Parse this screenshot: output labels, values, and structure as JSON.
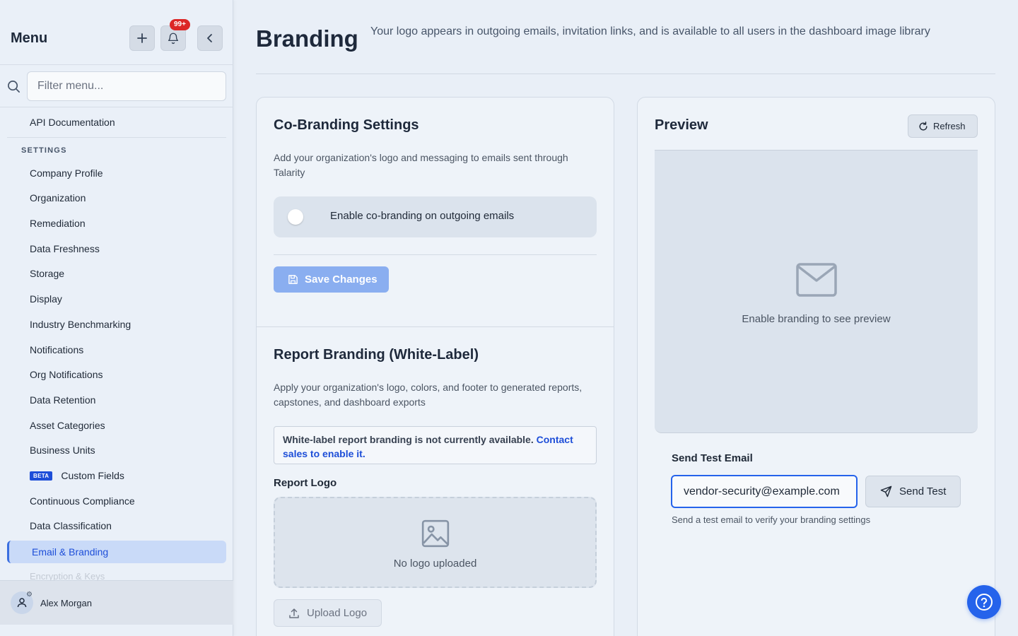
{
  "sidebar": {
    "title": "Menu",
    "notification_badge": "99+",
    "search_placeholder": "Filter menu...",
    "top_item": "API Documentation",
    "section_label": "SETTINGS",
    "items": [
      {
        "label": "Company Profile"
      },
      {
        "label": "Organization"
      },
      {
        "label": "Remediation"
      },
      {
        "label": "Data Freshness"
      },
      {
        "label": "Storage"
      },
      {
        "label": "Display"
      },
      {
        "label": "Industry Benchmarking"
      },
      {
        "label": "Notifications"
      },
      {
        "label": "Org Notifications"
      },
      {
        "label": "Data Retention"
      },
      {
        "label": "Asset Categories"
      },
      {
        "label": "Business Units"
      },
      {
        "label": "Custom Fields",
        "badge": "BETA"
      },
      {
        "label": "Continuous Compliance"
      },
      {
        "label": "Data Classification"
      }
    ],
    "active_item": "Email & Branding",
    "faded_item": "Encryption & Keys",
    "user_name": "Alex Morgan"
  },
  "header": {
    "title": "Branding",
    "description": "Your logo appears in outgoing emails, invitation links, and is available to all users in the dashboard image library"
  },
  "cobranding": {
    "title": "Co-Branding Settings",
    "description": "Add your organization's logo and messaging to emails sent through Talarity",
    "toggle_label": "Enable co-branding on outgoing emails",
    "toggle_on": false,
    "save_label": "Save Changes"
  },
  "report_branding": {
    "title": "Report Branding (White-Label)",
    "description": "Apply your organization's logo, colors, and footer to generated reports, capstones, and dashboard exports",
    "notice_text": "White-label report branding is not currently available.",
    "notice_link": "Contact sales to enable it.",
    "logo_label": "Report Logo",
    "no_logo_text": "No logo uploaded",
    "upload_label": "Upload Logo"
  },
  "preview": {
    "title": "Preview",
    "refresh_label": "Refresh",
    "empty_text": "Enable branding to see preview",
    "test_email_label": "Send Test Email",
    "test_email_value": "vendor-security@example.com",
    "send_label": "Send Test",
    "hint": "Send a test email to verify your branding settings"
  },
  "colors": {
    "accent": "#2563eb",
    "danger": "#dc2626",
    "active_bg": "#c9daf8"
  }
}
